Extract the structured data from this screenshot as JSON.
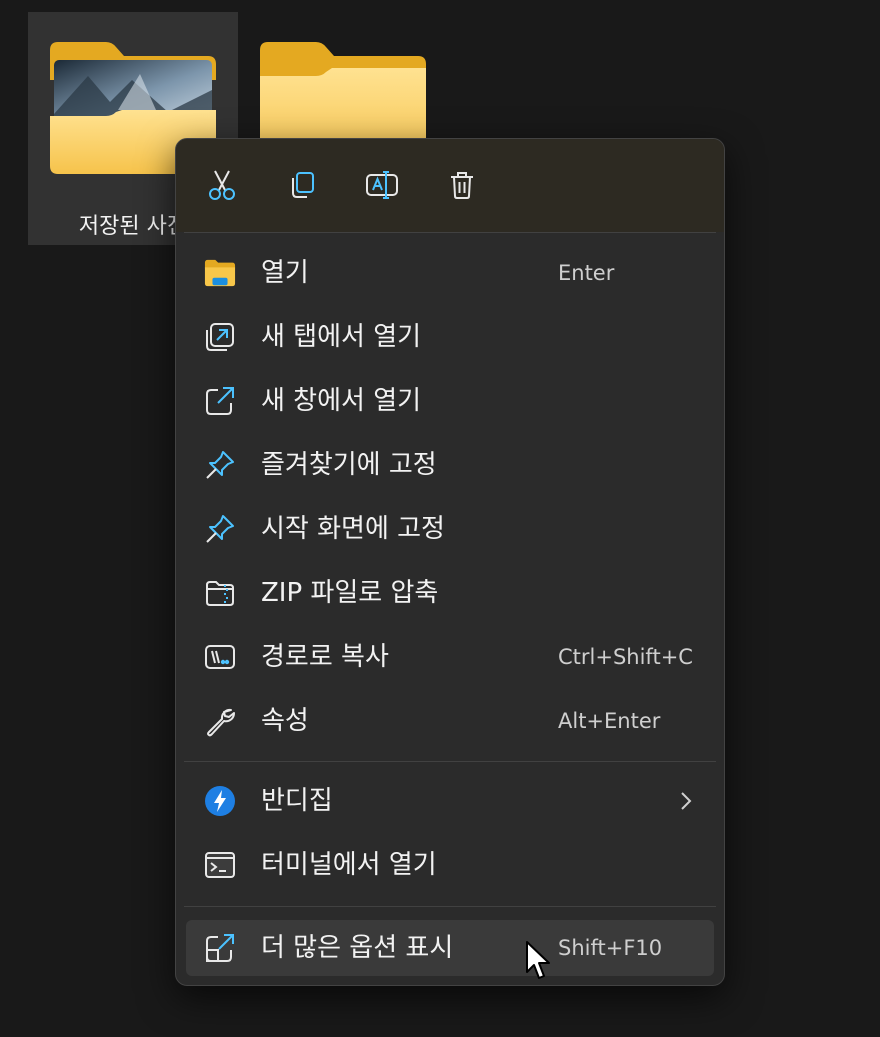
{
  "desktop": {
    "folders": [
      {
        "label": "저장된 사진",
        "selected": true,
        "has_preview": true
      },
      {
        "label": "",
        "selected": false,
        "has_preview": false
      }
    ]
  },
  "context_menu": {
    "toolbar": [
      {
        "name": "cut",
        "icon": "scissors-icon"
      },
      {
        "name": "copy",
        "icon": "copy-icon"
      },
      {
        "name": "rename",
        "icon": "rename-icon"
      },
      {
        "name": "delete",
        "icon": "trash-icon"
      }
    ],
    "items": [
      {
        "label": "열기",
        "accelerator": "Enter",
        "icon": "folder-open-icon"
      },
      {
        "label": "새 탭에서 열기",
        "accelerator": "",
        "icon": "new-tab-icon"
      },
      {
        "label": "새 창에서 열기",
        "accelerator": "",
        "icon": "new-window-icon"
      },
      {
        "label": "즐겨찾기에 고정",
        "accelerator": "",
        "icon": "pin-icon"
      },
      {
        "label": "시작 화면에 고정",
        "accelerator": "",
        "icon": "pin-icon"
      },
      {
        "label": "ZIP 파일로 압축",
        "accelerator": "",
        "icon": "zip-folder-icon"
      },
      {
        "label": "경로로 복사",
        "accelerator": "Ctrl+Shift+C",
        "icon": "copy-path-icon"
      },
      {
        "label": "속성",
        "accelerator": "Alt+Enter",
        "icon": "wrench-icon"
      },
      {
        "label": "반디집",
        "accelerator": "",
        "icon": "bandizip-icon",
        "has_submenu": true
      },
      {
        "label": "터미널에서 열기",
        "accelerator": "",
        "icon": "terminal-icon"
      },
      {
        "label": "더 많은 옵션 표시",
        "accelerator": "Shift+F10",
        "icon": "more-options-icon",
        "hovered": true
      }
    ]
  },
  "colors": {
    "menu_background": "#2b2b2b",
    "toolbar_tint": "#2d2a22",
    "icon_accent": "#4cc2ff",
    "folder_yellow": "#f8c74a",
    "hover_background": "#3a3a3a"
  }
}
